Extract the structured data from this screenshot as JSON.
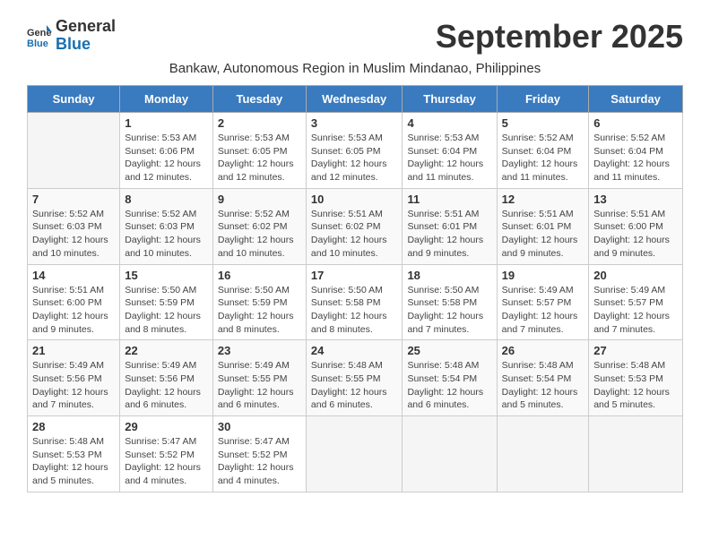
{
  "header": {
    "logo_line1": "General",
    "logo_line2": "Blue",
    "month_title": "September 2025",
    "subtitle": "Bankaw, Autonomous Region in Muslim Mindanao, Philippines"
  },
  "columns": [
    "Sunday",
    "Monday",
    "Tuesday",
    "Wednesday",
    "Thursday",
    "Friday",
    "Saturday"
  ],
  "weeks": [
    [
      {
        "day": "",
        "info": ""
      },
      {
        "day": "1",
        "info": "Sunrise: 5:53 AM\nSunset: 6:06 PM\nDaylight: 12 hours\nand 12 minutes."
      },
      {
        "day": "2",
        "info": "Sunrise: 5:53 AM\nSunset: 6:05 PM\nDaylight: 12 hours\nand 12 minutes."
      },
      {
        "day": "3",
        "info": "Sunrise: 5:53 AM\nSunset: 6:05 PM\nDaylight: 12 hours\nand 12 minutes."
      },
      {
        "day": "4",
        "info": "Sunrise: 5:53 AM\nSunset: 6:04 PM\nDaylight: 12 hours\nand 11 minutes."
      },
      {
        "day": "5",
        "info": "Sunrise: 5:52 AM\nSunset: 6:04 PM\nDaylight: 12 hours\nand 11 minutes."
      },
      {
        "day": "6",
        "info": "Sunrise: 5:52 AM\nSunset: 6:04 PM\nDaylight: 12 hours\nand 11 minutes."
      }
    ],
    [
      {
        "day": "7",
        "info": "Sunrise: 5:52 AM\nSunset: 6:03 PM\nDaylight: 12 hours\nand 10 minutes."
      },
      {
        "day": "8",
        "info": "Sunrise: 5:52 AM\nSunset: 6:03 PM\nDaylight: 12 hours\nand 10 minutes."
      },
      {
        "day": "9",
        "info": "Sunrise: 5:52 AM\nSunset: 6:02 PM\nDaylight: 12 hours\nand 10 minutes."
      },
      {
        "day": "10",
        "info": "Sunrise: 5:51 AM\nSunset: 6:02 PM\nDaylight: 12 hours\nand 10 minutes."
      },
      {
        "day": "11",
        "info": "Sunrise: 5:51 AM\nSunset: 6:01 PM\nDaylight: 12 hours\nand 9 minutes."
      },
      {
        "day": "12",
        "info": "Sunrise: 5:51 AM\nSunset: 6:01 PM\nDaylight: 12 hours\nand 9 minutes."
      },
      {
        "day": "13",
        "info": "Sunrise: 5:51 AM\nSunset: 6:00 PM\nDaylight: 12 hours\nand 9 minutes."
      }
    ],
    [
      {
        "day": "14",
        "info": "Sunrise: 5:51 AM\nSunset: 6:00 PM\nDaylight: 12 hours\nand 9 minutes."
      },
      {
        "day": "15",
        "info": "Sunrise: 5:50 AM\nSunset: 5:59 PM\nDaylight: 12 hours\nand 8 minutes."
      },
      {
        "day": "16",
        "info": "Sunrise: 5:50 AM\nSunset: 5:59 PM\nDaylight: 12 hours\nand 8 minutes."
      },
      {
        "day": "17",
        "info": "Sunrise: 5:50 AM\nSunset: 5:58 PM\nDaylight: 12 hours\nand 8 minutes."
      },
      {
        "day": "18",
        "info": "Sunrise: 5:50 AM\nSunset: 5:58 PM\nDaylight: 12 hours\nand 7 minutes."
      },
      {
        "day": "19",
        "info": "Sunrise: 5:49 AM\nSunset: 5:57 PM\nDaylight: 12 hours\nand 7 minutes."
      },
      {
        "day": "20",
        "info": "Sunrise: 5:49 AM\nSunset: 5:57 PM\nDaylight: 12 hours\nand 7 minutes."
      }
    ],
    [
      {
        "day": "21",
        "info": "Sunrise: 5:49 AM\nSunset: 5:56 PM\nDaylight: 12 hours\nand 7 minutes."
      },
      {
        "day": "22",
        "info": "Sunrise: 5:49 AM\nSunset: 5:56 PM\nDaylight: 12 hours\nand 6 minutes."
      },
      {
        "day": "23",
        "info": "Sunrise: 5:49 AM\nSunset: 5:55 PM\nDaylight: 12 hours\nand 6 minutes."
      },
      {
        "day": "24",
        "info": "Sunrise: 5:48 AM\nSunset: 5:55 PM\nDaylight: 12 hours\nand 6 minutes."
      },
      {
        "day": "25",
        "info": "Sunrise: 5:48 AM\nSunset: 5:54 PM\nDaylight: 12 hours\nand 6 minutes."
      },
      {
        "day": "26",
        "info": "Sunrise: 5:48 AM\nSunset: 5:54 PM\nDaylight: 12 hours\nand 5 minutes."
      },
      {
        "day": "27",
        "info": "Sunrise: 5:48 AM\nSunset: 5:53 PM\nDaylight: 12 hours\nand 5 minutes."
      }
    ],
    [
      {
        "day": "28",
        "info": "Sunrise: 5:48 AM\nSunset: 5:53 PM\nDaylight: 12 hours\nand 5 minutes."
      },
      {
        "day": "29",
        "info": "Sunrise: 5:47 AM\nSunset: 5:52 PM\nDaylight: 12 hours\nand 4 minutes."
      },
      {
        "day": "30",
        "info": "Sunrise: 5:47 AM\nSunset: 5:52 PM\nDaylight: 12 hours\nand 4 minutes."
      },
      {
        "day": "",
        "info": ""
      },
      {
        "day": "",
        "info": ""
      },
      {
        "day": "",
        "info": ""
      },
      {
        "day": "",
        "info": ""
      }
    ]
  ]
}
